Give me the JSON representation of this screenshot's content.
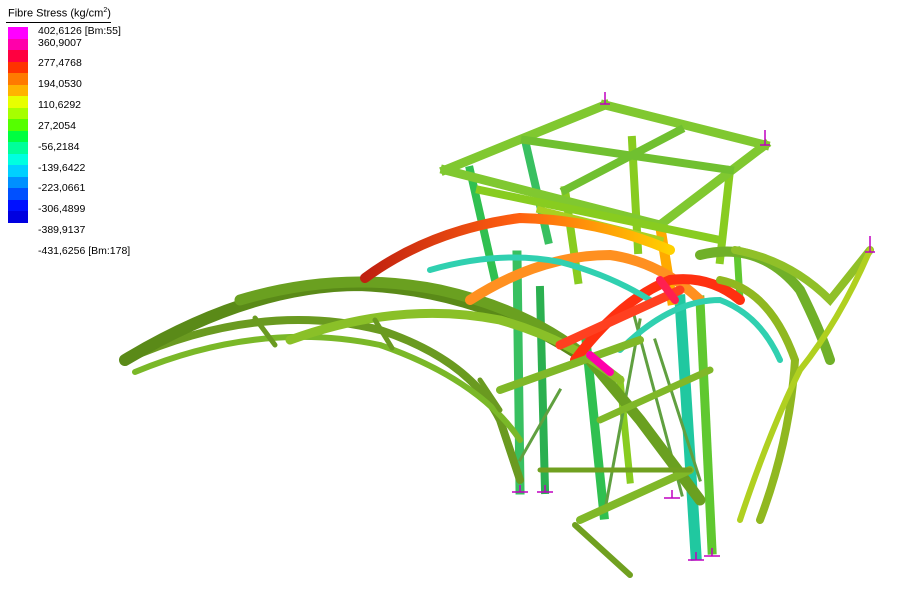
{
  "legend": {
    "title": "Fibre Stress (kg/cm",
    "title_sup": "2",
    "title_end": ")",
    "labels": [
      "402,6126 [Bm:55]",
      "360,9007",
      "277,4768",
      "194,0530",
      "110,6292",
      "27,2054",
      "-56,2184",
      "-139,6422",
      "-223,0661",
      "-306,4899",
      "-389,9137",
      "-431,6256 [Bm:178]"
    ],
    "colors": [
      "#ff00ff",
      "#ff00aa",
      "#ff0040",
      "#ff3300",
      "#ff7a00",
      "#ffb300",
      "#e8ff00",
      "#a6ff00",
      "#55ff00",
      "#00ff40",
      "#00ff9a",
      "#00ffe0",
      "#00d0ff",
      "#0090ff",
      "#0050ff",
      "#0010ff",
      "#0000e0"
    ]
  },
  "colors": {
    "member_green": "#7fd02a",
    "member_dark": "#3b6a10",
    "member_yellow": "#c8e020",
    "member_cyan": "#2fd2b0",
    "member_red": "#e02010",
    "member_orange": "#ff8a10",
    "support_magenta": "#c000c0",
    "background": "#ffffff"
  }
}
